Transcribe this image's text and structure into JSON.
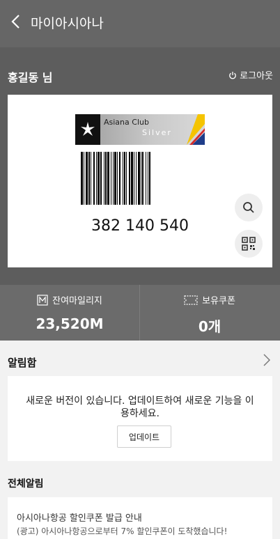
{
  "header": {
    "title": "마이아시아나"
  },
  "user": {
    "name": "홍길동 님",
    "logout_label": "로그아웃"
  },
  "card": {
    "club_name": "Asiana Club",
    "tier": "Silver",
    "number": "382 140 540"
  },
  "stats": {
    "mileage_label": "잔여마일리지",
    "mileage_value": "23,520M",
    "coupon_label": "보유쿠폰",
    "coupon_value": "0개"
  },
  "inbox": {
    "title": "알림함",
    "message": "새로운 버전이 있습니다. 업데이트하여 새로운 기능을 이용하세요.",
    "update_label": "업데이트"
  },
  "all_notices": {
    "title": "전체알림",
    "items": [
      {
        "title": "아시아나항공 할인쿠폰 발급 안내",
        "preview": "(광고) 아시아나항공으로부터 7% 할인쿠폰이 도착했습니다!"
      }
    ]
  },
  "icons": [
    "back-arrow-icon",
    "power-icon",
    "star-alliance-icon",
    "search-icon",
    "qr-code-icon",
    "mileage-icon",
    "coupon-icon",
    "chevron-right-icon"
  ]
}
